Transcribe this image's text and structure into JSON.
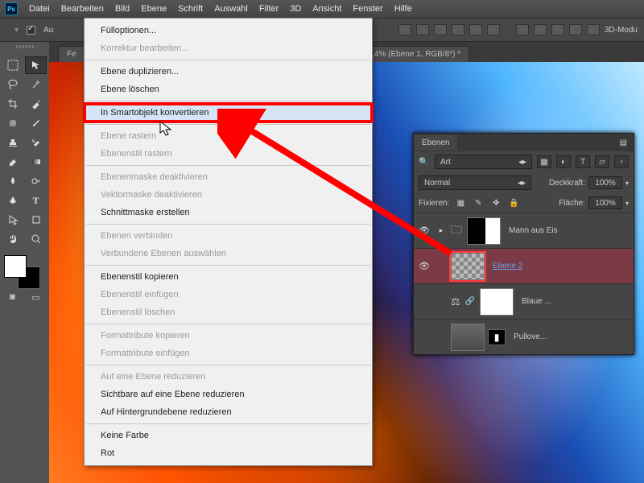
{
  "menubar": {
    "items": [
      "Datei",
      "Bearbeiten",
      "Bild",
      "Ebene",
      "Schrift",
      "Auswahl",
      "Filter",
      "3D",
      "Ansicht",
      "Fenster",
      "Hilfe"
    ]
  },
  "optionbar": {
    "auto_label": "Au",
    "group_label": "3D-Modu"
  },
  "tab": {
    "label": "16,4% (Ebene 1, RGB/8*) *"
  },
  "menu": {
    "groups": [
      [
        {
          "label": "Fülloptionen...",
          "disabled": false
        },
        {
          "label": "Korrektur bearbeiten...",
          "disabled": true
        }
      ],
      [
        {
          "label": "Ebene duplizieren...",
          "disabled": false
        },
        {
          "label": "Ebene löschen",
          "disabled": false
        }
      ],
      [
        {
          "label": "In Smartobjekt konvertieren",
          "disabled": false,
          "highlight": true,
          "marked": true
        }
      ],
      [
        {
          "label": "Ebene rastern",
          "disabled": true
        },
        {
          "label": "Ebenenstil rastern",
          "disabled": true
        }
      ],
      [
        {
          "label": "Ebenenmaske deaktivieren",
          "disabled": true
        },
        {
          "label": "Vektormaske deaktivieren",
          "disabled": true
        },
        {
          "label": "Schnittmaske erstellen",
          "disabled": false
        }
      ],
      [
        {
          "label": "Ebenen verbinden",
          "disabled": true
        },
        {
          "label": "Verbundene Ebenen auswählen",
          "disabled": true
        }
      ],
      [
        {
          "label": "Ebenenstil kopieren",
          "disabled": false
        },
        {
          "label": "Ebenenstil einfügen",
          "disabled": true
        },
        {
          "label": "Ebenenstil löschen",
          "disabled": true
        }
      ],
      [
        {
          "label": "Formattribute kopieren",
          "disabled": true
        },
        {
          "label": "Formattribute einfügen",
          "disabled": true
        }
      ],
      [
        {
          "label": "Auf eine Ebene reduzieren",
          "disabled": true
        },
        {
          "label": "Sichtbare auf eine Ebene reduzieren",
          "disabled": false
        },
        {
          "label": "Auf Hintergrundebene reduzieren",
          "disabled": false
        }
      ],
      [
        {
          "label": "Keine Farbe",
          "disabled": false
        },
        {
          "label": "Rot",
          "disabled": false
        }
      ]
    ]
  },
  "layers_panel": {
    "title": "Ebenen",
    "kind_label": "Art",
    "blend_mode": "Normal",
    "opacity_label": "Deckkraft:",
    "opacity_value": "100%",
    "lock_label": "Fixieren:",
    "fill_label": "Fläche:",
    "fill_value": "100%",
    "layers": [
      {
        "name": "Mann aus Eis",
        "thumb": "half",
        "folder": true,
        "vis": true
      },
      {
        "name": "Ebene 2",
        "thumb": "checker",
        "selected": true,
        "link": true,
        "vis": true
      },
      {
        "name": "Blaue ...",
        "thumb": "white",
        "linked": true,
        "balance": true,
        "vis": false
      },
      {
        "name": "Pullove...",
        "thumb": "grey",
        "mask": true,
        "vis": false
      }
    ]
  }
}
